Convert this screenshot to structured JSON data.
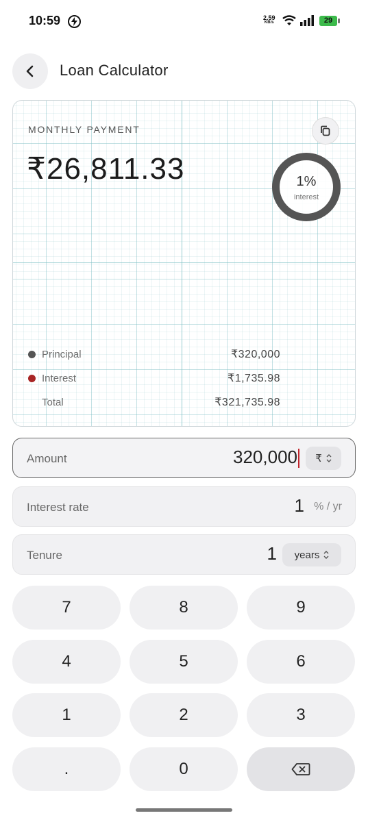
{
  "status_bar": {
    "time": "10:59",
    "net_speed": "2.59",
    "net_unit": "KB/s",
    "battery": "29"
  },
  "header": {
    "title": "Loan Calculator"
  },
  "result": {
    "label": "MONTHLY PAYMENT",
    "monthly_payment": "₹26,811.33",
    "donut_percent": "1%",
    "donut_label": "interest",
    "donut_share": 0.01,
    "legend": [
      {
        "name": "Principal",
        "value": "₹320,000",
        "color": "#555555"
      },
      {
        "name": "Interest",
        "value": "₹1,735.98",
        "color": "#a82525"
      },
      {
        "name": "Total",
        "value": "₹321,735.98",
        "color": ""
      }
    ]
  },
  "fields": {
    "amount": {
      "label": "Amount",
      "value": "320,000",
      "unit": "₹"
    },
    "interest": {
      "label": "Interest rate",
      "value": "1",
      "unit": "% / yr"
    },
    "tenure": {
      "label": "Tenure",
      "value": "1",
      "unit": "years"
    }
  },
  "keypad": {
    "keys": [
      "7",
      "8",
      "9",
      "4",
      "5",
      "6",
      "1",
      "2",
      "3",
      ".",
      "0"
    ],
    "backspace_icon": "backspace-icon"
  }
}
